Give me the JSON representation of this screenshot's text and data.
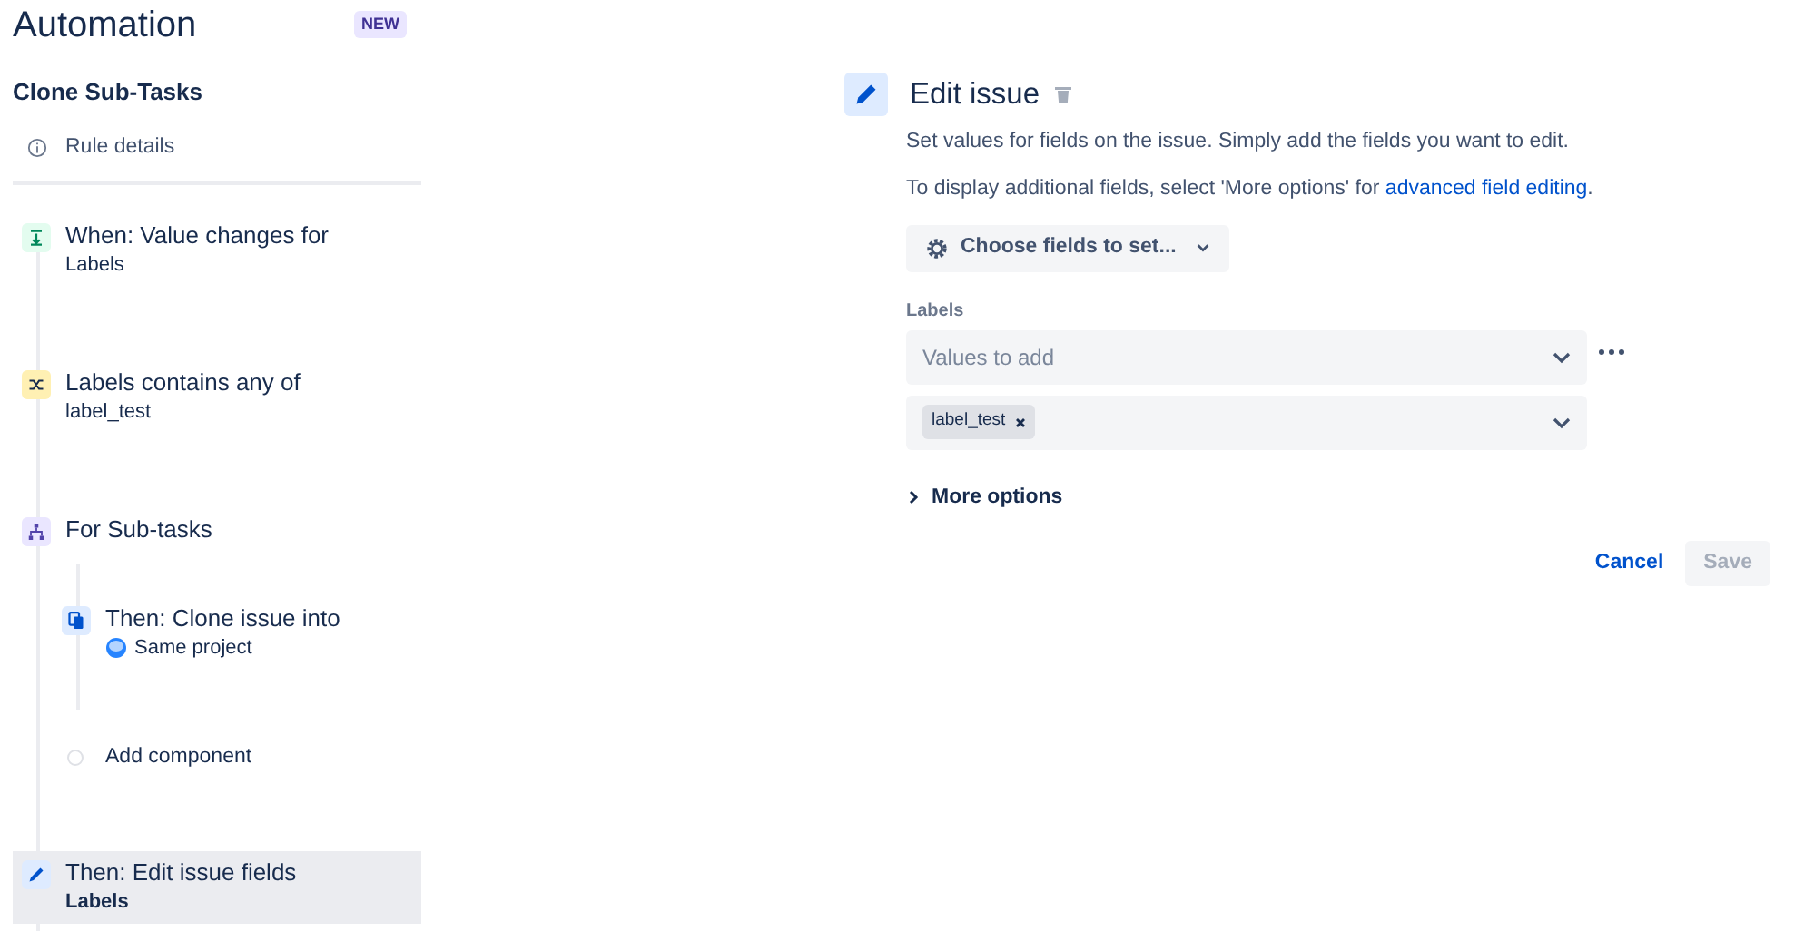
{
  "sidebar": {
    "title": "Automation",
    "badge": "NEW",
    "rule_name": "Clone Sub-Tasks",
    "rule_details": "Rule details",
    "steps": [
      {
        "kind": "trigger",
        "title": "When: Value changes for",
        "subtitle": "Labels",
        "selected": false
      },
      {
        "kind": "condition",
        "title": "Labels contains any of",
        "subtitle": "label_test",
        "selected": false
      },
      {
        "kind": "branch",
        "title": "For Sub-tasks",
        "selected": false,
        "children": [
          {
            "kind": "clone",
            "title": "Then: Clone issue into",
            "subtitle": "Same project",
            "selected": false
          },
          {
            "kind": "add",
            "title": "Add component",
            "selected": false
          }
        ]
      },
      {
        "kind": "action",
        "title": "Then: Edit issue fields",
        "subtitle": "Labels",
        "selected": true
      }
    ]
  },
  "editor": {
    "title": "Edit issue",
    "description": "Set values for fields on the issue. Simply add the fields you want to edit.",
    "hint": "To display additional fields, select 'More options' for",
    "hint_link": "advanced field editing",
    "hint_end": ".",
    "choose_button": "Choose fields to set...",
    "field_label": "Labels",
    "mode_placeholder": "Values to add",
    "tags": [
      "label_test"
    ],
    "more_options": "More options",
    "more_options_expanded": false,
    "cancel": "Cancel",
    "save": "Save",
    "save_disabled": true
  }
}
